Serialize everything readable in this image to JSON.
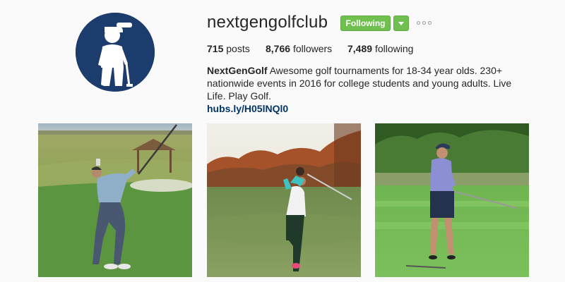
{
  "profile": {
    "username": "nextgengolfclub",
    "avatar_icon": "golfer-silhouette-icon",
    "follow_button_label": "Following",
    "dropdown_icon": "caret-down-icon",
    "more_icon": "ellipsis-icon",
    "stats": {
      "posts_count": "715",
      "posts_label": "posts",
      "followers_count": "8,766",
      "followers_label": "followers",
      "following_count": "7,489",
      "following_label": "following"
    },
    "bio": {
      "full_name": "NextGenGolf",
      "text": "Awesome golf tournaments for 18-34 year olds. 230+ nationwide events in 2016 for college students and young adults. Live Life. Play Golf.",
      "link": "hubs.ly/H05lNQl0"
    }
  },
  "colors": {
    "follow_green": "#70c050",
    "avatar_navy": "#1d3c6e",
    "link_blue": "#003569",
    "background": "#fafafa"
  }
}
